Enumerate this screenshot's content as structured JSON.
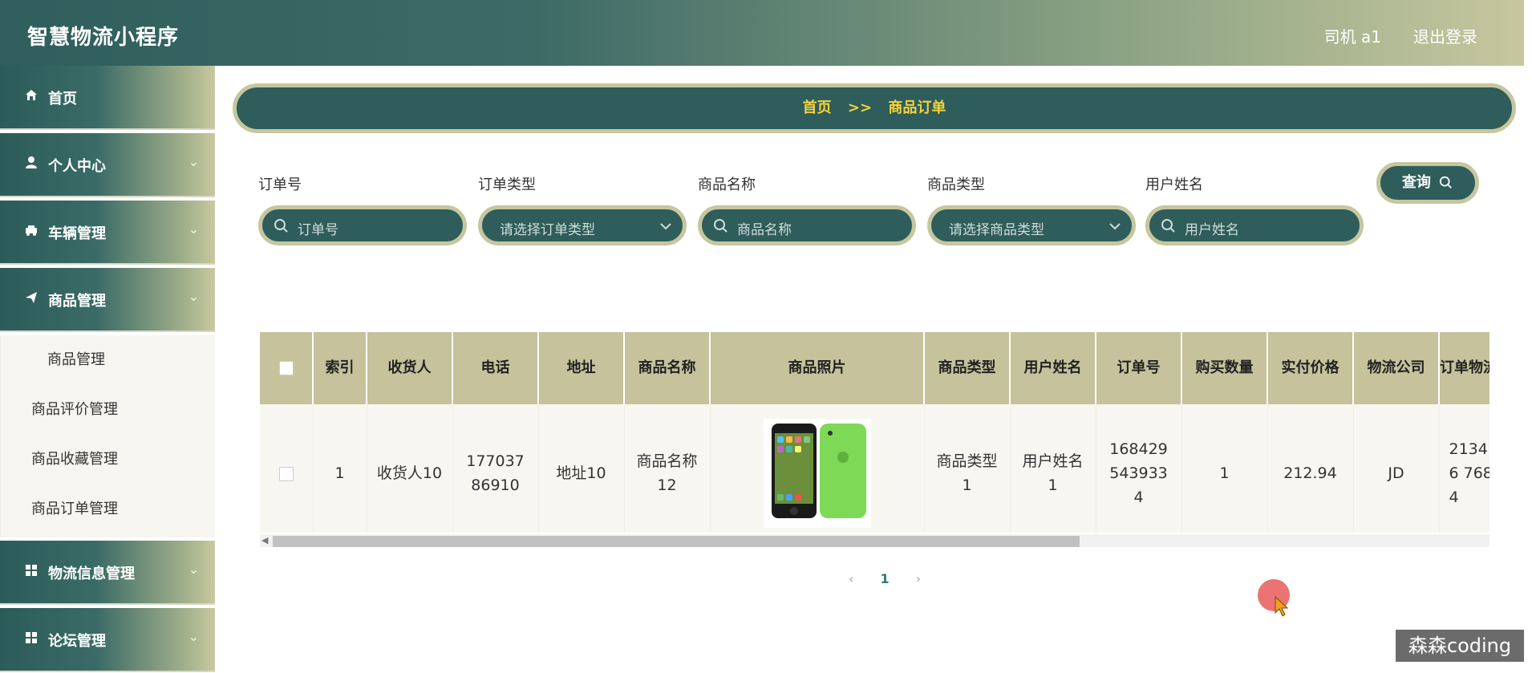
{
  "header": {
    "title": "智慧物流小程序",
    "user": "司机 a1",
    "logout": "退出登录"
  },
  "sidebar": {
    "items": [
      {
        "label": "首页",
        "icon": "home-icon"
      },
      {
        "label": "个人中心",
        "icon": "user-icon"
      },
      {
        "label": "车辆管理",
        "icon": "car-icon"
      },
      {
        "label": "商品管理",
        "icon": "send-icon"
      }
    ],
    "submenu": [
      "商品管理",
      "商品评价管理",
      "商品收藏管理",
      "商品订单管理"
    ],
    "items_after": [
      {
        "label": "物流信息管理",
        "icon": "grid-icon"
      },
      {
        "label": "论坛管理",
        "icon": "grid-icon"
      }
    ]
  },
  "breadcrumb": {
    "home": "首页",
    "sep": ">>",
    "current": "商品订单"
  },
  "filters": {
    "order_no": {
      "label": "订单号",
      "placeholder": "订单号"
    },
    "order_type": {
      "label": "订单类型",
      "placeholder": "请选择订单类型"
    },
    "product_name": {
      "label": "商品名称",
      "placeholder": "商品名称"
    },
    "product_type": {
      "label": "商品类型",
      "placeholder": "请选择商品类型"
    },
    "user_name": {
      "label": "用户姓名",
      "placeholder": "用户姓名"
    },
    "query": "查询"
  },
  "table": {
    "headers": [
      "索引",
      "收货人",
      "电话",
      "地址",
      "商品名称",
      "商品照片",
      "商品类型",
      "用户姓名",
      "订单号",
      "购买数量",
      "实付价格",
      "物流公司",
      "订单物流单号"
    ],
    "row": {
      "index": "1",
      "receiver": "收货人10",
      "phone": "17703786910",
      "address": "地址10",
      "product_name": "商品名称12",
      "product_type": "商品类型1",
      "user_name": "用户姓名1",
      "order_no": "1684295439334",
      "quantity": "1",
      "price": "212.94",
      "logistics": "JD",
      "tracking": "21346 7684"
    }
  },
  "pager": {
    "prev": "‹",
    "current": "1",
    "next": "›"
  },
  "watermark": "森森coding",
  "colors": {
    "primary": "#2e5d5b",
    "accent_border": "#c6c69f",
    "breadcrumb_text": "#f3d33a",
    "table_header": "#c5c29c"
  }
}
